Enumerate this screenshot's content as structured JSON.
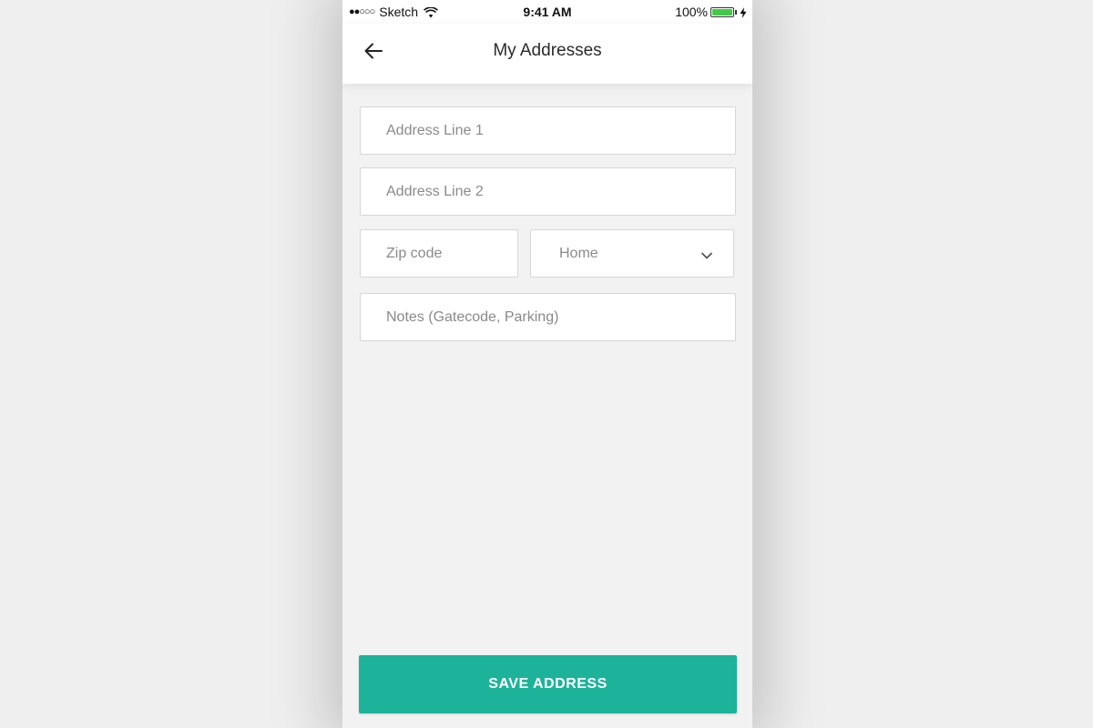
{
  "status_bar": {
    "signal": "●●○○○",
    "carrier": "Sketch",
    "time": "9:41 AM",
    "battery": "100%",
    "wifi_icon": "wifi-icon",
    "battery_level": 1.0,
    "battery_color": "#3fcb45"
  },
  "header": {
    "title": "My Addresses",
    "back_icon": "arrow-left-icon"
  },
  "form": {
    "address_line_1": {
      "placeholder": "Address Line 1",
      "value": ""
    },
    "address_line_2": {
      "placeholder": "Address Line 2",
      "value": ""
    },
    "zip_code": {
      "placeholder": "Zip code",
      "value": ""
    },
    "address_type": {
      "selected": "Home",
      "icon": "chevron-down-icon"
    },
    "notes": {
      "placeholder": "Notes (Gatecode, Parking)",
      "value": ""
    }
  },
  "actions": {
    "save_label": "SAVE ADDRESS",
    "accent_color": "#1db39b"
  }
}
